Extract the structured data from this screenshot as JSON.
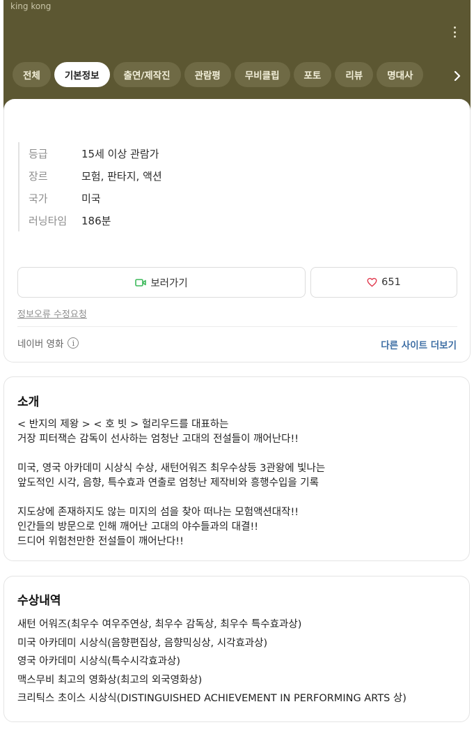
{
  "app": {
    "title": "king kong"
  },
  "tabs": [
    {
      "label": "전체"
    },
    {
      "label": "기본정보"
    },
    {
      "label": "출연/제작진"
    },
    {
      "label": "관람평"
    },
    {
      "label": "무비클립"
    },
    {
      "label": "포토"
    },
    {
      "label": "리뷰"
    },
    {
      "label": "명대사"
    }
  ],
  "active_tab": "기본정보",
  "info": [
    {
      "key": "등급",
      "value": "15세 이상 관람가"
    },
    {
      "key": "장르",
      "value": "모험, 판타지, 액션"
    },
    {
      "key": "국가",
      "value": "미국"
    },
    {
      "key": "러닝타임",
      "value": "186분"
    }
  ],
  "actions": {
    "watch_label": "보러가기",
    "like_count": "651"
  },
  "links": {
    "report": "정보오류 수정요청",
    "source": "네이버 영화",
    "more_sites": "다른 사이트 더보기"
  },
  "intro": {
    "title": "소개",
    "paragraphs": [
      [
        "< 반지의 제왕 > < 호 빗 > 헐리우드를 대표하는",
        "거장 피터잭슨 감독이 선사하는 엄청난 고대의 전설들이 깨어난다!!"
      ],
      [
        "미국, 영국 아카데미 시상식 수상, 새턴어워즈 최우수상등 3관왕에 빛나는",
        "앞도적인 시각, 음향, 특수효과 연출로 엄청난 제작비와 흥행수입을 기록"
      ],
      [
        "지도상에 존재하지도 않는 미지의 섬을 찾아 떠나는 모험액션대작!!",
        "인간들의 방문으로 인해 깨어난 고대의 야수들과의 대결!!",
        "드디어 위험천만한 전설들이 깨어난다!!"
      ]
    ]
  },
  "awards": {
    "title": "수상내역",
    "items": [
      "새턴 어워즈(최우수 여우주연상, 최우수 감독상, 최우수 특수효과상)",
      "미국 아카데미 시상식(음향편집상, 음향믹싱상, 시각효과상)",
      "영국 아카데미 시상식(특수시각효과상)",
      "맥스무비 최고의 영화상(최고의 외국영화상)",
      "크리틱스 초이스 시상식(DISTINGUISHED ACHIEVEMENT IN PERFORMING ARTS 상)"
    ]
  },
  "colors": {
    "header_bg": "#5c5732",
    "tab_bg": "#6f6a45",
    "link_blue": "#3f6fa5",
    "camera_green": "#3cb95a",
    "heart_red": "#e0364b"
  },
  "icons": {
    "more": "kebab-menu-icon",
    "next": "chevron-right-icon",
    "watch": "video-camera-icon",
    "like": "heart-icon",
    "info": "info-icon"
  }
}
